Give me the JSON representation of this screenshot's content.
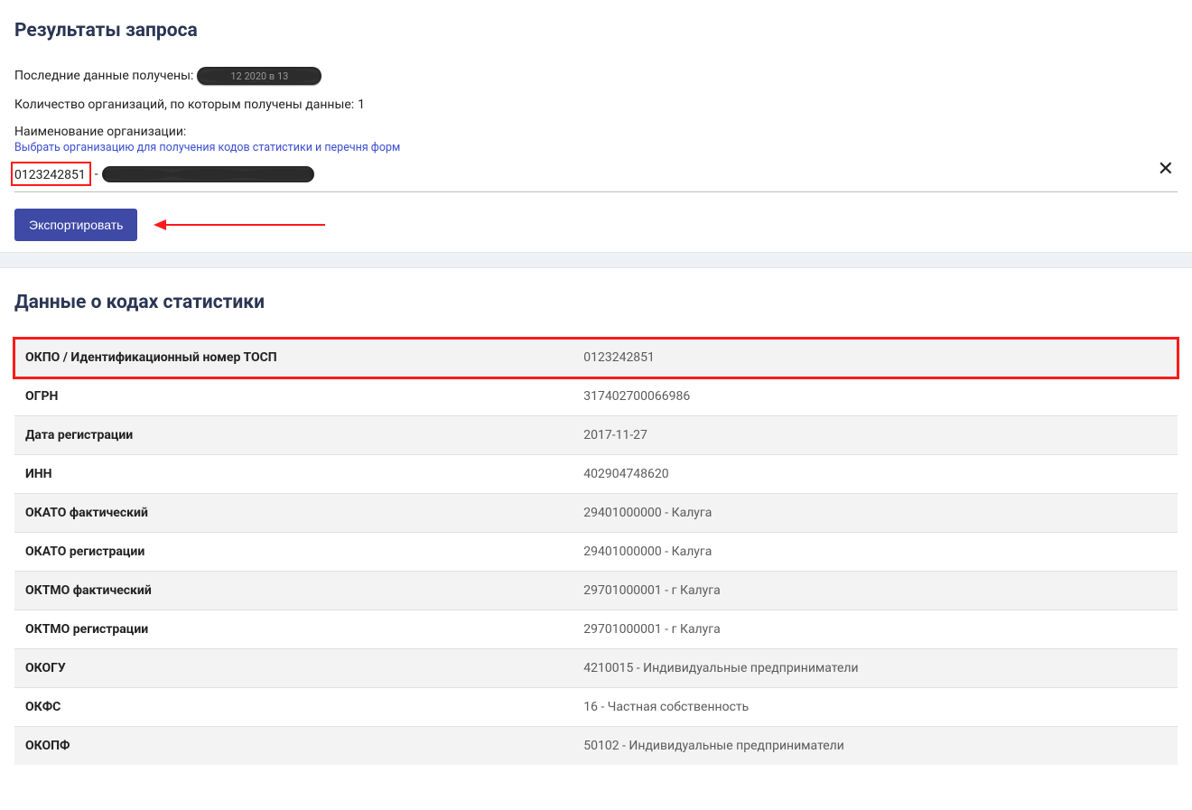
{
  "top": {
    "heading": "Результаты запроса",
    "last_data_label": "Последние данные получены:",
    "last_data_value_hint": "12 2020 в 13",
    "org_count_label": "Количество организаций, по которым получены данные:",
    "org_count_value": "1",
    "org_name_label": "Наименование организации:",
    "org_select_hint": "Выбрать организацию для получения кодов статистики и перечня форм",
    "org_number": "0123242851",
    "org_separator": "-",
    "clear_icon": "✕",
    "export_button": "Экспортировать"
  },
  "bottom": {
    "heading": "Данные о кодах статистики",
    "rows": [
      {
        "k": "ОКПО / Идентификационный номер ТОСП",
        "v": "0123242851"
      },
      {
        "k": "ОГРН",
        "v": "317402700066986"
      },
      {
        "k": "Дата регистрации",
        "v": "2017-11-27"
      },
      {
        "k": "ИНН",
        "v": "402904748620"
      },
      {
        "k": "ОКАТО фактический",
        "v": "29401000000 - Калуга"
      },
      {
        "k": "ОКАТО регистрации",
        "v": "29401000000 - Калуга"
      },
      {
        "k": "ОКТМО фактический",
        "v": "29701000001 - г Калуга"
      },
      {
        "k": "ОКТМО регистрации",
        "v": "29701000001 - г Калуга"
      },
      {
        "k": "ОКОГУ",
        "v": "4210015 - Индивидуальные предприниматели"
      },
      {
        "k": "ОКФС",
        "v": "16 - Частная собственность"
      },
      {
        "k": "ОКОПФ",
        "v": "50102 - Индивидуальные предприниматели"
      }
    ]
  },
  "annotations": {
    "highlighted_row_index": 0
  }
}
